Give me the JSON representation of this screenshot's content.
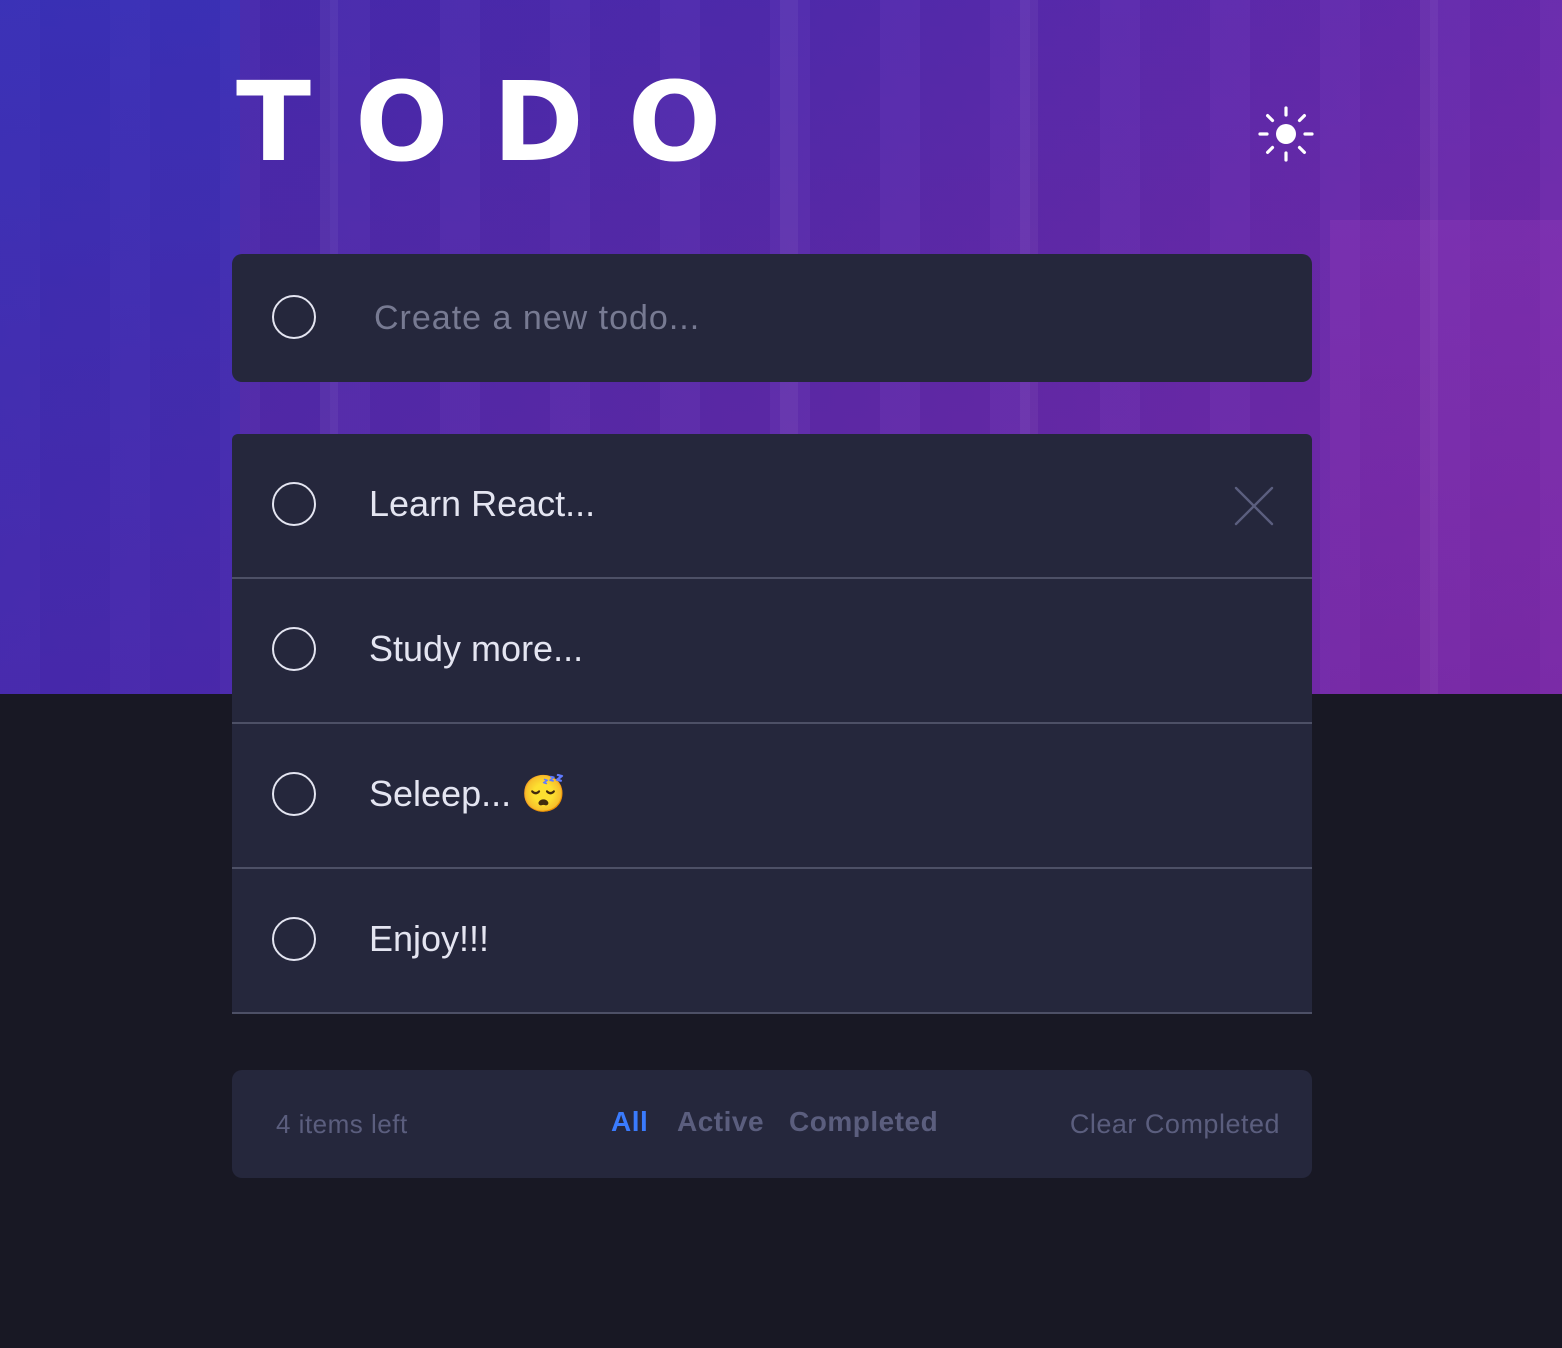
{
  "app": {
    "title": "TODO"
  },
  "header": {
    "theme_toggle_icon": "sun-icon"
  },
  "new_todo": {
    "placeholder": "Create a new todo...",
    "value": ""
  },
  "todos": [
    {
      "text": "Learn React...",
      "completed": false
    },
    {
      "text": "Study more...",
      "completed": false
    },
    {
      "text": "Seleep... 😴",
      "completed": false
    },
    {
      "text": "Enjoy!!!",
      "completed": false
    }
  ],
  "footer": {
    "items_left": "4 items left",
    "filters": [
      "All",
      "Active",
      "Completed"
    ],
    "active_filter": "All",
    "clear_label": "Clear Completed"
  },
  "colors": {
    "accent": "#3a7bfd",
    "panel": "#25273c",
    "background": "#181824",
    "text": "#e4e5f1",
    "muted": "#5b5e7e"
  }
}
